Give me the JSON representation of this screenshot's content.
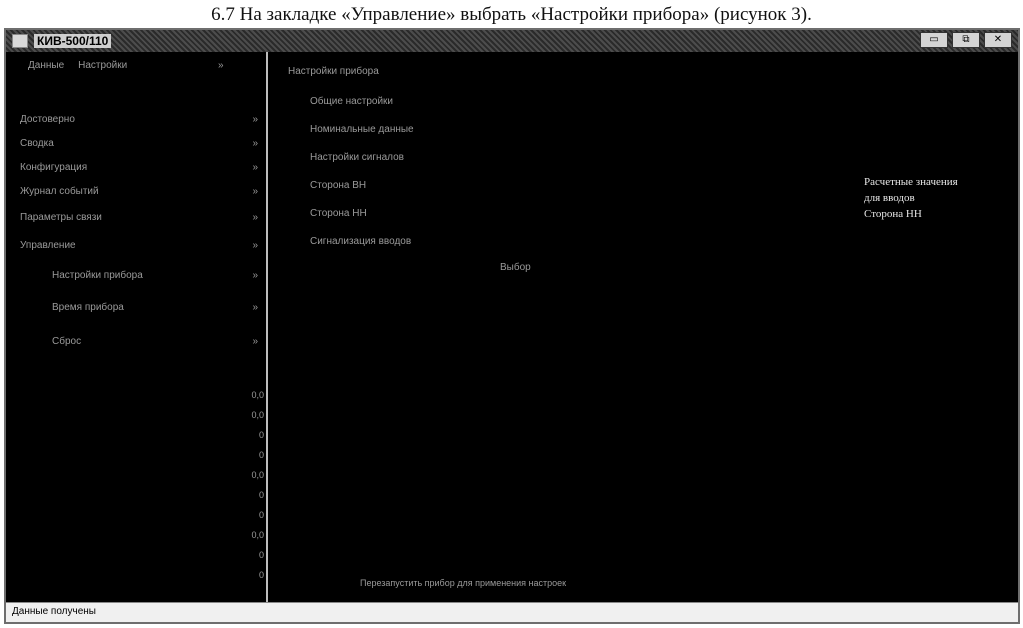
{
  "caption": "6.7  На закладке «Управление» выбрать «Настройки прибора» (рисунок 3).",
  "window": {
    "title": "КИВ-500/110",
    "buttons": {
      "minimize": "▭",
      "restore": "⧉",
      "close": "✕"
    }
  },
  "sidebar": {
    "tabs": [
      "Данные",
      "Настройки"
    ],
    "top_arrow": "»",
    "items": [
      {
        "label": "Достоверно",
        "arrow": "»"
      },
      {
        "label": "Сводка",
        "arrow": "»"
      },
      {
        "label": "Конфигурация",
        "arrow": "»"
      },
      {
        "label": "Журнал событий",
        "arrow": "»"
      },
      {
        "label": "Параметры связи",
        "arrow": "»"
      },
      {
        "label": "Управление",
        "arrow": "»"
      }
    ],
    "subitems": [
      {
        "label": "Настройки прибора",
        "arrow": "»"
      },
      {
        "label": "Время прибора",
        "arrow": "»"
      },
      {
        "label": "Сброс",
        "arrow": "»"
      }
    ],
    "values": [
      "0,0",
      "0,0",
      "0",
      "0",
      "0,0",
      "0",
      "0",
      "0,0",
      "0",
      "0"
    ]
  },
  "main": {
    "heading": "Настройки прибора",
    "items": [
      "Общие настройки",
      "Номинальные данные",
      "Настройки сигналов",
      "Сторона ВН",
      "Сторона НН",
      "Сигнализация вводов"
    ],
    "note": "Выбор",
    "calc_values": [
      "Расчетные значения",
      "для вводов",
      "Сторона НН"
    ],
    "bottom_text": "Перезапустить прибор для применения настроек"
  },
  "status": {
    "text": "Данные получены"
  }
}
